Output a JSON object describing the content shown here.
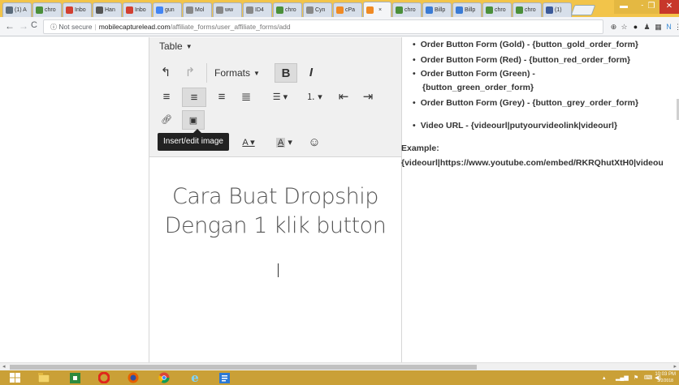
{
  "browser": {
    "tabs": [
      {
        "label": "(1) A",
        "color": "#5a6a7a"
      },
      {
        "label": "chro",
        "color": "#4b8f3a"
      },
      {
        "label": "Inbo",
        "color": "#d23f31"
      },
      {
        "label": "Han",
        "color": "#555555"
      },
      {
        "label": "Inbo",
        "color": "#d23f31"
      },
      {
        "label": "gun",
        "color": "#4285f4"
      },
      {
        "label": "Mol",
        "color": "#888888"
      },
      {
        "label": "ww",
        "color": "#888888"
      },
      {
        "label": "ID4",
        "color": "#888888"
      },
      {
        "label": "chro",
        "color": "#4b8f3a"
      },
      {
        "label": "Cyn",
        "color": "#888888"
      },
      {
        "label": "cPa",
        "color": "#f08a24"
      },
      {
        "label": "",
        "color": "#f08a24",
        "active": true
      },
      {
        "label": "chro",
        "color": "#4b8f3a"
      },
      {
        "label": "Billp",
        "color": "#3a7bd5"
      },
      {
        "label": "Billp",
        "color": "#3a7bd5"
      },
      {
        "label": "chro",
        "color": "#4b8f3a"
      },
      {
        "label": "chro",
        "color": "#4b8f3a"
      },
      {
        "label": "(1)",
        "color": "#3b5998"
      }
    ],
    "address": {
      "security": "Not secure",
      "host": "mobilecapturelead.com",
      "path": "/affiliate_forms/user_affiliate_forms/add"
    }
  },
  "editor": {
    "menu_label": "Table",
    "formats_label": "Formats",
    "tooltip": "Insert/edit image",
    "content_heading_line1": "Cara Buat Dropship",
    "content_heading_line2": "Dengan 1 klik button"
  },
  "help": {
    "items": [
      "Order Button Form (Gold) - {button_gold_order_form}",
      "Order Button Form (Red) - {button_red_order_form}",
      "Order Button Form (Green) -",
      "{button_green_order_form}",
      "Order Button Form (Grey) - {button_grey_order_form}",
      "Video URL - {videourl|putyourvideolink|videourl}"
    ],
    "example_label": "Example:",
    "example_code": "{videourl|https://www.youtube.com/embed/RKRQhutXtH0|videou"
  },
  "taskbar": {
    "time": "10:03 PM",
    "date": "3/2/2018"
  }
}
